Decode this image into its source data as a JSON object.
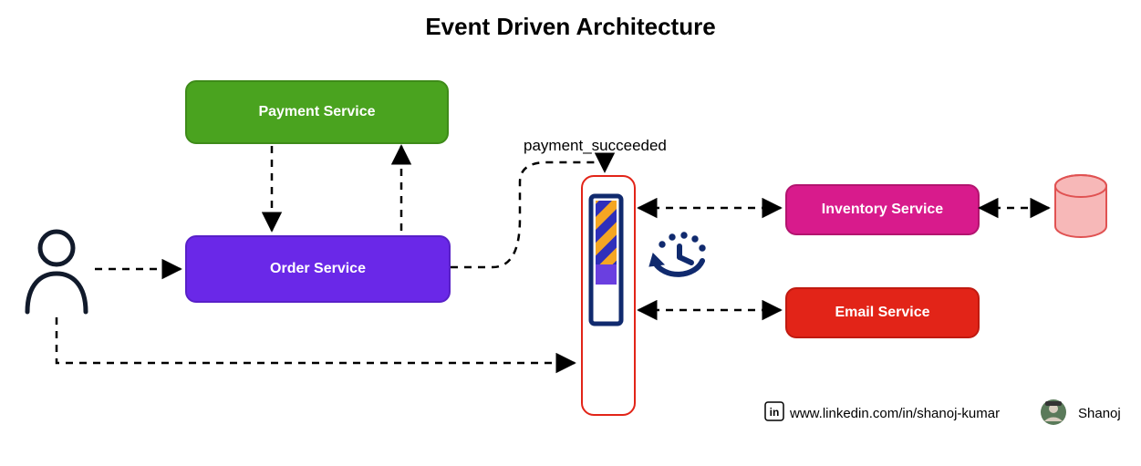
{
  "title": "Event Driven Architecture",
  "event_label": "payment_succeeded",
  "services": {
    "payment": "Payment Service",
    "order": "Order Service",
    "inventory": "Inventory Service",
    "email": "Email Service"
  },
  "footer": {
    "link": "www.linkedin.com/in/shanoj-kumar",
    "name": "Shanoj"
  },
  "colors": {
    "payment": "#4aa31f",
    "order": "#6a28e8",
    "inventory": "#d81b8c",
    "email": "#e22418",
    "bus_border": "#e22418",
    "arrow": "#000000",
    "db_fill": "#f7b8b8",
    "db_stroke": "#e05252"
  },
  "icons": {
    "user": "user-icon",
    "bus": "message-bus-icon",
    "db": "database-icon",
    "linkedin": "linkedin-icon",
    "avatar": "avatar-icon"
  }
}
